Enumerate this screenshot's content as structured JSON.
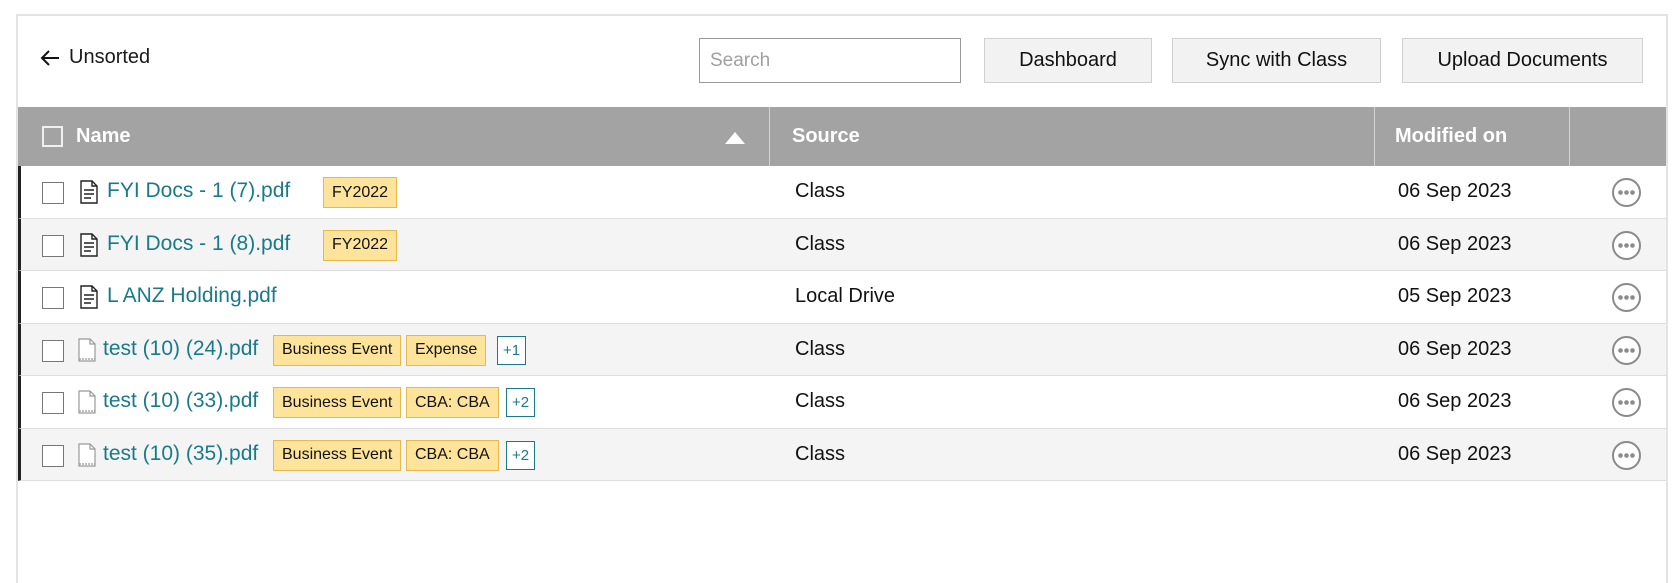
{
  "toolbar": {
    "back_label": "Unsorted",
    "search_placeholder": "Search",
    "dashboard_label": "Dashboard",
    "sync_label": "Sync with Class",
    "upload_label": "Upload Documents"
  },
  "table": {
    "columns": {
      "name": "Name",
      "source": "Source",
      "modified": "Modified on"
    },
    "sort": {
      "column": "Name",
      "direction": "ascending"
    },
    "rows": [
      {
        "name": "FYI Docs - 1 (7).pdf",
        "icon": "document-lines-icon",
        "tags": [
          "FY2022"
        ],
        "more": "",
        "source": "Class",
        "modified": "06 Sep 2023"
      },
      {
        "name": "FYI Docs - 1 (8).pdf",
        "icon": "document-lines-icon",
        "tags": [
          "FY2022"
        ],
        "more": "",
        "source": "Class",
        "modified": "06 Sep 2023"
      },
      {
        "name": "L ANZ Holding.pdf",
        "icon": "document-lines-icon",
        "tags": [],
        "more": "",
        "source": "Local Drive",
        "modified": "05 Sep 2023"
      },
      {
        "name": "test (10) (24).pdf",
        "icon": "document-blank-icon",
        "tags": [
          "Business Event",
          "Expense"
        ],
        "more": "+1",
        "source": "Class",
        "modified": "06 Sep 2023"
      },
      {
        "name": "test (10) (33).pdf",
        "icon": "document-blank-icon",
        "tags": [
          "Business Event",
          "CBA: CBA"
        ],
        "more": "+2",
        "source": "Class",
        "modified": "06 Sep 2023"
      },
      {
        "name": "test (10) (35).pdf",
        "icon": "document-blank-icon",
        "tags": [
          "Business Event",
          "CBA: CBA"
        ],
        "more": "+2",
        "source": "Class",
        "modified": "06 Sep 2023"
      }
    ]
  },
  "colors": {
    "link": "#1a7a8a",
    "header_bg": "#a3a3a3",
    "tag_bg": "#fde49a",
    "tag_border": "#e6b94c"
  }
}
